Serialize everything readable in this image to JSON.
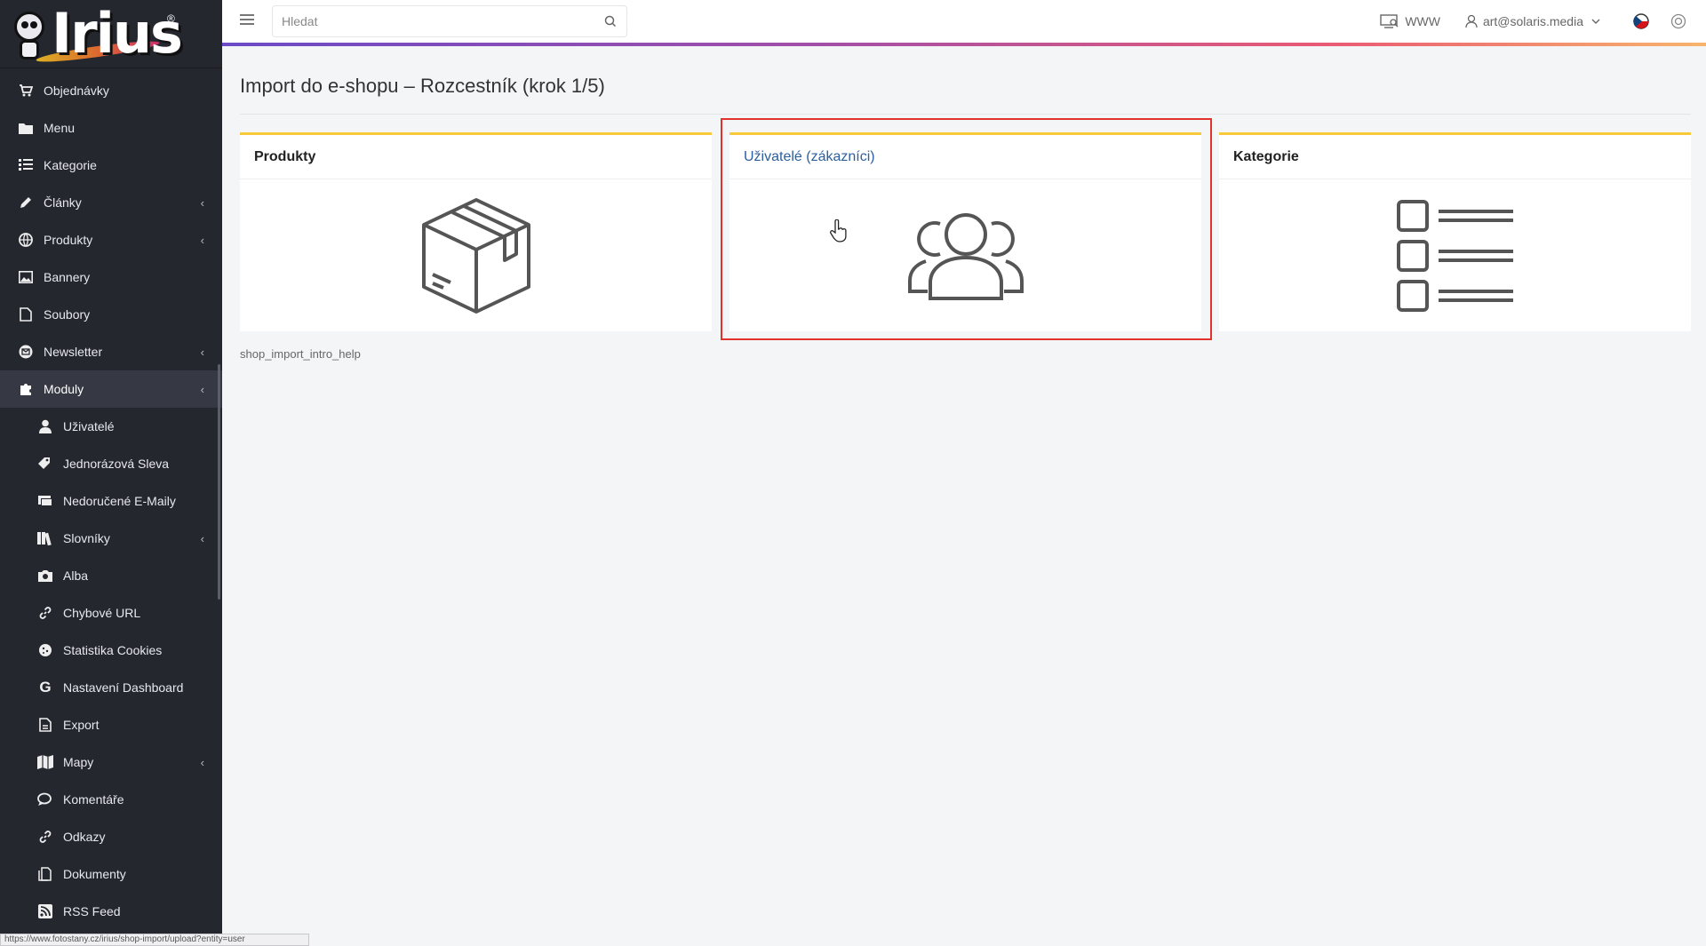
{
  "brand": {
    "logo_text": "Irius",
    "registered": "®"
  },
  "sidebar": {
    "items": [
      {
        "label": "Objednávky",
        "icon": "cart-icon"
      },
      {
        "label": "Menu",
        "icon": "folder-icon"
      },
      {
        "label": "Kategorie",
        "icon": "list-icon"
      },
      {
        "label": "Články",
        "icon": "pencil-icon",
        "chevron": true
      },
      {
        "label": "Produkty",
        "icon": "globe-icon",
        "chevron": true
      },
      {
        "label": "Bannery",
        "icon": "image-icon"
      },
      {
        "label": "Soubory",
        "icon": "file-icon"
      },
      {
        "label": "Newsletter",
        "icon": "newsletter-icon",
        "chevron": true
      },
      {
        "label": "Moduly",
        "icon": "puzzle-icon",
        "chevron": true,
        "active": true
      },
      {
        "label": "Uživatelé",
        "icon": "user-icon",
        "sub": true
      },
      {
        "label": "Jednorázová Sleva",
        "icon": "tags-icon",
        "sub": true
      },
      {
        "label": "Nedoručené E-Maily",
        "icon": "envelope-icon",
        "sub": true
      },
      {
        "label": "Slovníky",
        "icon": "books-icon",
        "sub": true,
        "chevron": true
      },
      {
        "label": "Alba",
        "icon": "camera-icon",
        "sub": true
      },
      {
        "label": "Chybové URL",
        "icon": "link-icon",
        "sub": true
      },
      {
        "label": "Statistika Cookies",
        "icon": "cookie-icon",
        "sub": true
      },
      {
        "label": "Nastavení Dashboard",
        "icon": "google-icon",
        "sub": true
      },
      {
        "label": "Export",
        "icon": "export-icon",
        "sub": true
      },
      {
        "label": "Mapy",
        "icon": "map-icon",
        "sub": true,
        "chevron": true
      },
      {
        "label": "Komentáře",
        "icon": "comments-icon",
        "sub": true
      },
      {
        "label": "Odkazy",
        "icon": "link-icon",
        "sub": true
      },
      {
        "label": "Dokumenty",
        "icon": "documents-icon",
        "sub": true
      },
      {
        "label": "RSS Feed",
        "icon": "rss-icon",
        "sub": true
      }
    ]
  },
  "topbar": {
    "search_placeholder": "Hledat",
    "www_label": "WWW",
    "user_label": "art@solaris.media"
  },
  "main": {
    "title": "Import do e-shopu – Rozcestník (krok 1/5)",
    "cards": [
      {
        "title": "Produkty",
        "icon": "box-icon"
      },
      {
        "title": "Uživatelé (zákazníci)",
        "icon": "users-icon"
      },
      {
        "title": "Kategorie",
        "icon": "checklist-icon"
      }
    ],
    "help": "shop_import_intro_help"
  },
  "statusbar": {
    "url": "https://www.fotostany.cz/irius/shop-import/upload?entity=user"
  },
  "colors": {
    "sidebar_bg": "#25272f",
    "card_accent": "#f7c93b",
    "highlight": "#e0332b",
    "link": "#2c5f9e"
  }
}
